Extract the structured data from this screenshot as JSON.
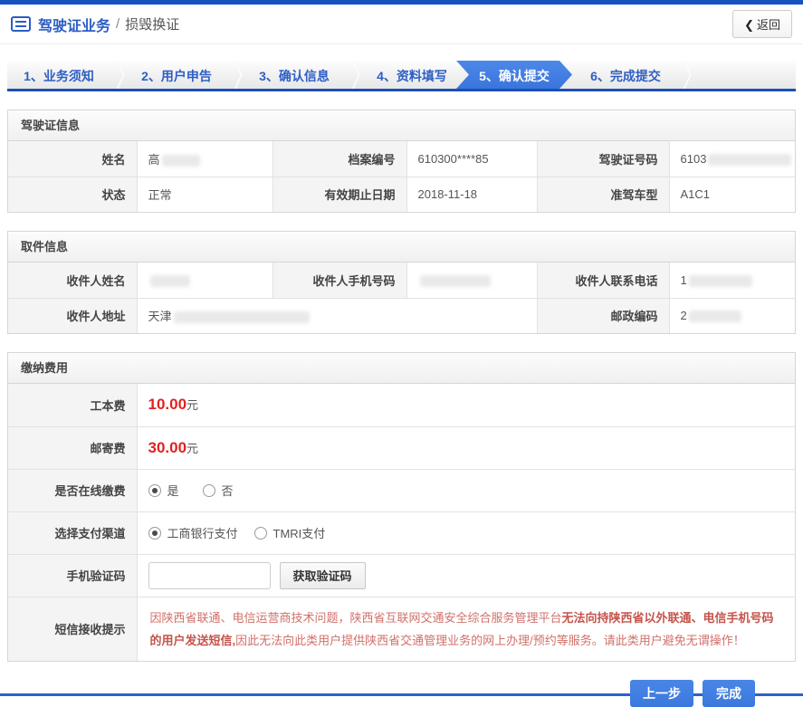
{
  "colors": {
    "topbar_blue": "#1553c0",
    "title_blue": "#2b5cc4",
    "active_step_blue": "#3d7ce0",
    "button_blue": "#417fe0",
    "price_red": "#e02222",
    "notice_red": "#d0706a"
  },
  "header": {
    "title": "驾驶证业务",
    "separator": "/",
    "subtitle": "损毁换证",
    "back_icon": "❮",
    "back_label": "返回"
  },
  "steps": [
    {
      "label": "1、业务须知",
      "active": false
    },
    {
      "label": "2、用户申告",
      "active": false
    },
    {
      "label": "3、确认信息",
      "active": false
    },
    {
      "label": "4、资料填写",
      "active": false
    },
    {
      "label": "5、确认提交",
      "active": true
    },
    {
      "label": "6、完成提交",
      "active": false
    }
  ],
  "license": {
    "title": "驾驶证信息",
    "name_label": "姓名",
    "name_prefix": "高",
    "file_no_label": "档案编号",
    "file_no": "610300****85",
    "license_no_label": "驾驶证号码",
    "license_no_prefix": "6103",
    "status_label": "状态",
    "status": "正常",
    "expiry_label": "有效期止日期",
    "expiry": "2018-11-18",
    "vehicle_class_label": "准驾车型",
    "vehicle_class": "A1C1"
  },
  "pickup": {
    "title": "取件信息",
    "recipient_name_label": "收件人姓名",
    "recipient_mobile_label": "收件人手机号码",
    "recipient_phone_label": "收件人联系电话",
    "recipient_phone_prefix": "1",
    "recipient_address_label": "收件人地址",
    "recipient_address_prefix": "天津",
    "postcode_label": "邮政编码",
    "postcode_prefix": "2"
  },
  "fees": {
    "title": "缴纳费用",
    "production_fee_label": "工本费",
    "production_fee": "10.00",
    "postage_fee_label": "邮寄费",
    "postage_fee": "30.00",
    "currency": "元",
    "online_payment_label": "是否在线缴费",
    "online_yes": "是",
    "online_no": "否",
    "online_selected": "是",
    "channel_label": "选择支付渠道",
    "channel_icbc": "工商银行支付",
    "channel_tmri": "TMRI支付",
    "channel_selected": "工商银行支付",
    "sms_code_label": "手机验证码",
    "sms_code_value": "",
    "get_code_button": "获取验证码",
    "notice_label": "短信接收提示",
    "notice_part1": "因陕西省联通、电信运营商技术问题，陕西省互联网交通安全综合服务管理平台",
    "notice_part2": "无法向持陕西省以外联通、电信手机号码的用户发送短信,",
    "notice_part3": "因此无法向此类用户提供陕西省交通管理业务的网上办理/预约等服务。请此类用户避免无谓操作！"
  },
  "footer": {
    "prev_button": "上一步",
    "finish_button": "完成"
  }
}
